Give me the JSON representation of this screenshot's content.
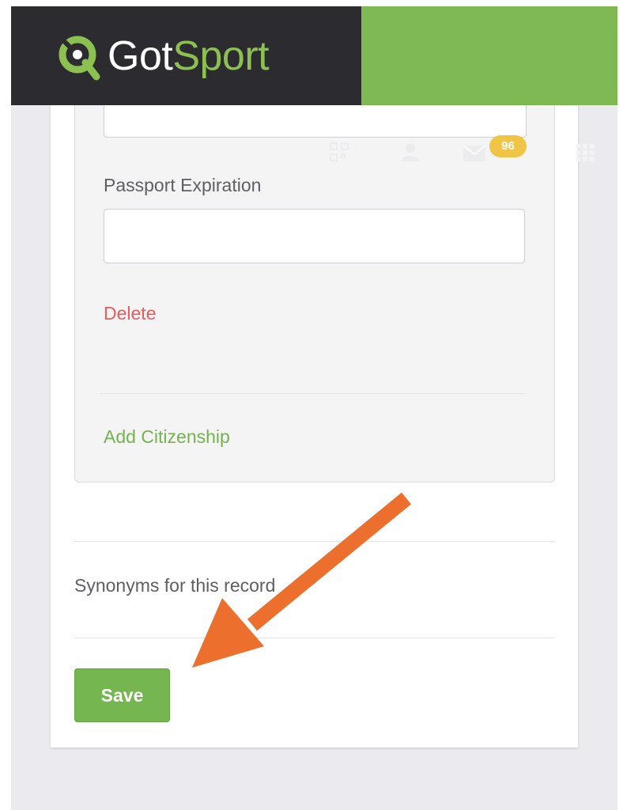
{
  "header": {
    "logo_part1": "Got",
    "logo_part2": "Sport",
    "colors": {
      "dark": "#2b2b30",
      "green": "#7fb954"
    }
  },
  "nav": {
    "icons": [
      "qr-code-icon",
      "user-icon",
      "mail-icon",
      "grid-menu-icon"
    ],
    "mail_badge": "96"
  },
  "form": {
    "passport_expiration_label": "Passport Expiration",
    "passport_expiration_value": "",
    "delete_label": "Delete",
    "add_citizenship_label": "Add Citizenship",
    "synonyms_label": "Synonyms for this record",
    "save_label": "Save"
  },
  "annotation": {
    "arrow_color": "#ec6f2d",
    "points_to": "save-button"
  }
}
